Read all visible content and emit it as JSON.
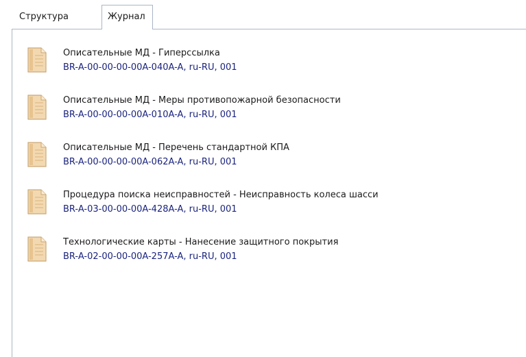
{
  "tabs": [
    {
      "label": "Структура",
      "active": false
    },
    {
      "label": "Журнал",
      "active": true
    }
  ],
  "journal": {
    "items": [
      {
        "title": "Описательные МД - Гиперссылка",
        "code": "BR-A-00-00-00-00A-040A-A, ru-RU, 001",
        "icon": "document-icon"
      },
      {
        "title": "Описательные МД - Меры противопожарной безопасности",
        "code": "BR-A-00-00-00-00A-010A-A, ru-RU, 001",
        "icon": "document-icon"
      },
      {
        "title": "Описательные МД - Перечень стандартной КПА",
        "code": "BR-A-00-00-00-00A-062A-A, ru-RU, 001",
        "icon": "document-icon"
      },
      {
        "title": "Процедура поиска неисправностей - Неисправность колеса шасси",
        "code": "BR-A-03-00-00-00A-428A-A, ru-RU, 001",
        "icon": "document-icon"
      },
      {
        "title": "Технологические карты - Нанесение защитного покрытия",
        "code": "BR-A-02-00-00-00A-257A-A, ru-RU, 001",
        "icon": "document-icon"
      }
    ]
  },
  "colors": {
    "code_text": "#1a237e",
    "tab_border": "#a9b6c4",
    "icon_fill": "#f3d9b1"
  }
}
